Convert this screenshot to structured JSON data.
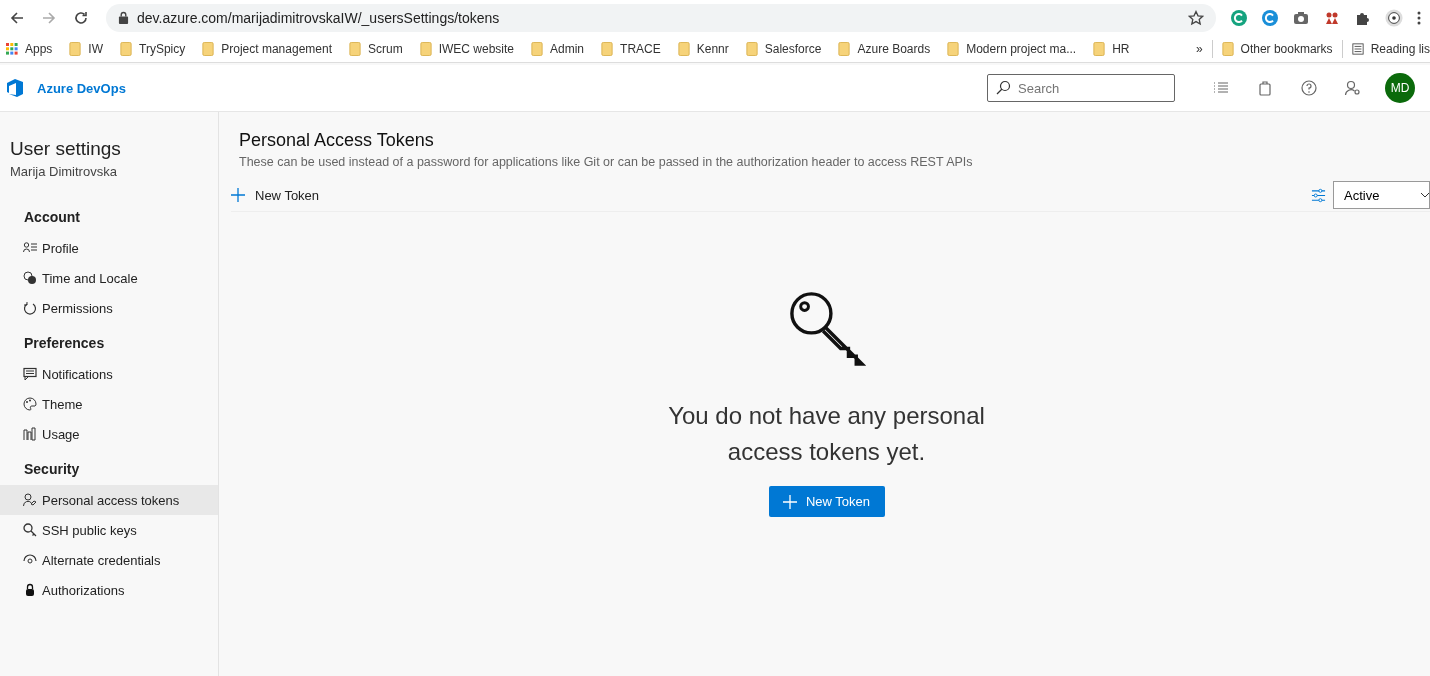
{
  "browser": {
    "url": "dev.azure.com/marijadimitrovskaIW/_usersSettings/tokens",
    "bookmarks": [
      "Apps",
      "IW",
      "TrySpicy",
      "Project management",
      "Scrum",
      "IWEC website",
      "Admin",
      "TRACE",
      "Kennr",
      "Salesforce",
      "Azure Boards",
      "Modern project ma...",
      "HR"
    ],
    "overflow": "»",
    "other_bookmarks": "Other bookmarks",
    "reading_list": "Reading lis"
  },
  "header": {
    "brand": "Azure DevOps",
    "search": {
      "placeholder": "Search"
    },
    "avatar": "MD"
  },
  "sidebar": {
    "title": "User settings",
    "user": "Marija Dimitrovska",
    "sections": [
      {
        "heading": "Account",
        "items": [
          {
            "label": "Profile",
            "selected": false
          },
          {
            "label": "Time and Locale",
            "selected": false
          },
          {
            "label": "Permissions",
            "selected": false
          }
        ]
      },
      {
        "heading": "Preferences",
        "items": [
          {
            "label": "Notifications",
            "selected": false
          },
          {
            "label": "Theme",
            "selected": false
          },
          {
            "label": "Usage",
            "selected": false
          }
        ]
      },
      {
        "heading": "Security",
        "items": [
          {
            "label": "Personal access tokens",
            "selected": true
          },
          {
            "label": "SSH public keys",
            "selected": false
          },
          {
            "label": "Alternate credentials",
            "selected": false
          },
          {
            "label": "Authorizations",
            "selected": false
          }
        ]
      }
    ]
  },
  "main": {
    "title": "Personal Access Tokens",
    "description": "These can be used instead of a password for applications like Git or can be passed in the authorization header to access REST APIs",
    "new_token": "New Token",
    "filter": "Active",
    "empty": {
      "message": "You do not have any personal access tokens yet.",
      "button": "New Token"
    }
  }
}
